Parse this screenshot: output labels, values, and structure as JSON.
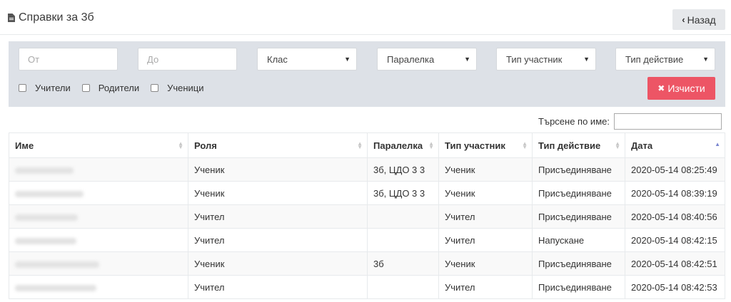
{
  "header": {
    "title": "Справки за 3б",
    "back_label": "Назад"
  },
  "filters": {
    "from_placeholder": "От",
    "to_placeholder": "До",
    "class_select": "Клас",
    "section_select": "Паралелка",
    "participant_type_select": "Тип участник",
    "action_type_select": "Тип действие",
    "checkboxes": [
      "Учители",
      "Родители",
      "Ученици"
    ],
    "clear_label": "Изчисти"
  },
  "search": {
    "label": "Търсене по име:",
    "value": ""
  },
  "table": {
    "columns": [
      "Име",
      "Роля",
      "Паралелка",
      "Тип участник",
      "Тип действие",
      "Дата"
    ],
    "rows": [
      {
        "role": "Ученик",
        "section": "3б, ЦДО 3 3",
        "participant": "Ученик",
        "action": "Присъединяване",
        "date": "2020-05-14 08:25:49"
      },
      {
        "role": "Ученик",
        "section": "3б, ЦДО 3 3",
        "participant": "Ученик",
        "action": "Присъединяване",
        "date": "2020-05-14 08:39:19"
      },
      {
        "role": "Учител",
        "section": "",
        "participant": "Учител",
        "action": "Присъединяване",
        "date": "2020-05-14 08:40:56"
      },
      {
        "role": "Учител",
        "section": "",
        "participant": "Учител",
        "action": "Напускане",
        "date": "2020-05-14 08:42:15"
      },
      {
        "role": "Ученик",
        "section": "3б",
        "participant": "Ученик",
        "action": "Присъединяване",
        "date": "2020-05-14 08:42:51"
      },
      {
        "role": "Учител",
        "section": "",
        "participant": "Учител",
        "action": "Присъединяване",
        "date": "2020-05-14 08:42:53"
      }
    ]
  },
  "colors": {
    "clear_button": "#ed5565",
    "filter_panel": "#dde1e7",
    "sort_active": "#7a86d0"
  }
}
